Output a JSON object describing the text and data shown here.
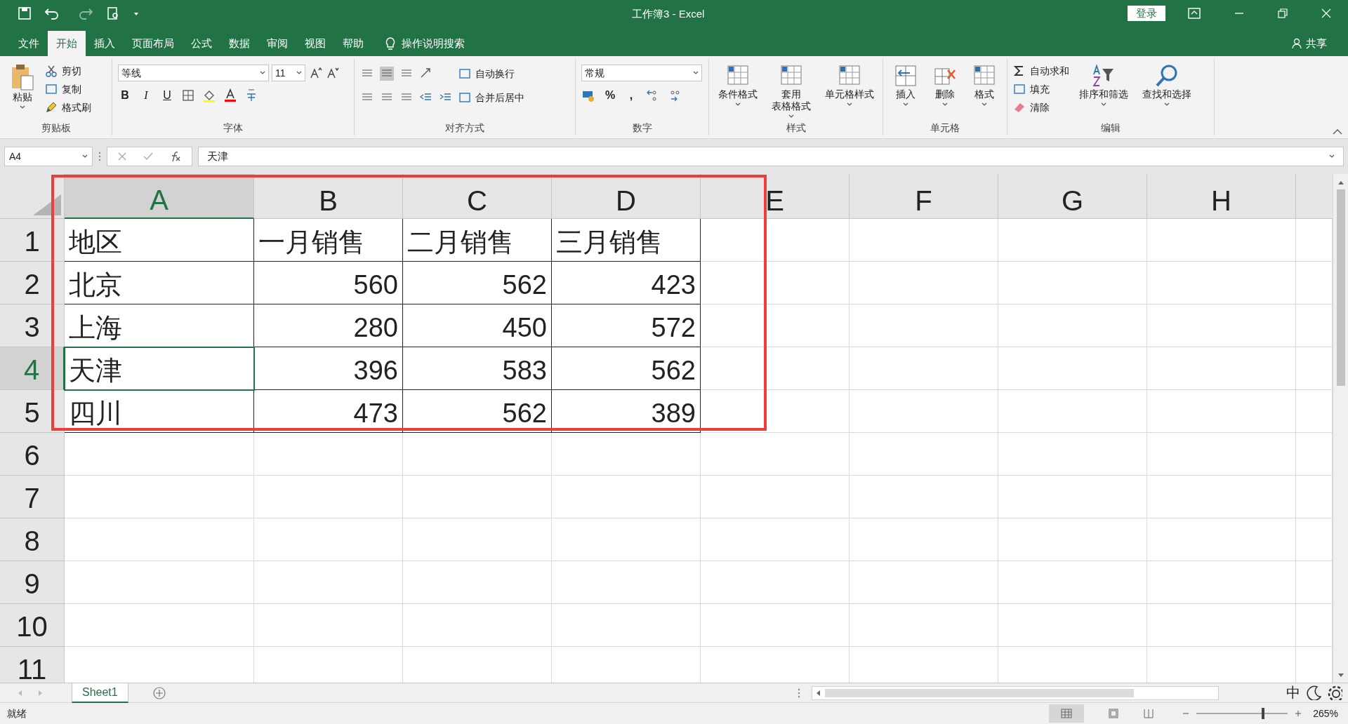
{
  "window": {
    "title": "工作簿3  -  Excel",
    "login": "登录"
  },
  "ribbon_tabs": [
    {
      "label": "文件",
      "selected": false
    },
    {
      "label": "开始",
      "selected": true
    },
    {
      "label": "插入",
      "selected": false
    },
    {
      "label": "页面布局",
      "selected": false
    },
    {
      "label": "公式",
      "selected": false
    },
    {
      "label": "数据",
      "selected": false
    },
    {
      "label": "审阅",
      "selected": false
    },
    {
      "label": "视图",
      "selected": false
    },
    {
      "label": "帮助",
      "selected": false
    }
  ],
  "tell_me": "操作说明搜索",
  "share": "共享",
  "ribbon_groups": [
    {
      "kind": "clipboard",
      "label": "剪贴板",
      "large": [
        {
          "lines": [
            "粘贴"
          ]
        }
      ],
      "small": [
        "剪切",
        "复制",
        "格式刷"
      ]
    },
    {
      "kind": "font",
      "label": "字体",
      "font": "等线",
      "size": "11",
      "buttons": [
        "B",
        "I",
        "U"
      ]
    },
    {
      "kind": "alignment",
      "label": "对齐方式",
      "small": [
        "自动换行",
        "合并后居中"
      ]
    },
    {
      "kind": "number",
      "label": "数字",
      "format": "常规",
      "buttons": [
        "%",
        ","
      ]
    },
    {
      "kind": "large",
      "label": "样式",
      "large": [
        {
          "lines": [
            "条件格式"
          ]
        },
        {
          "lines": [
            "套用",
            "表格格式"
          ]
        },
        {
          "lines": [
            "单元格样式"
          ]
        }
      ]
    },
    {
      "kind": "large",
      "label": "单元格",
      "large": [
        {
          "lines": [
            "插入"
          ]
        },
        {
          "lines": [
            "删除"
          ]
        },
        {
          "lines": [
            "格式"
          ]
        }
      ]
    },
    {
      "kind": "editing",
      "label": "编辑",
      "small": [
        "自动求和",
        "填充",
        "清除"
      ],
      "large": [
        {
          "lines": [
            "排序和筛选"
          ]
        },
        {
          "lines": [
            "查找和选择"
          ]
        }
      ]
    }
  ],
  "formula_bar": {
    "name_box": "A4",
    "formula": "天津"
  },
  "columns": [
    {
      "label": "A",
      "selected": true
    },
    {
      "label": "B",
      "selected": false
    },
    {
      "label": "C",
      "selected": false
    },
    {
      "label": "D",
      "selected": false
    },
    {
      "label": "E",
      "selected": false
    },
    {
      "label": "F",
      "selected": false
    },
    {
      "label": "G",
      "selected": false
    },
    {
      "label": "H",
      "selected": false
    }
  ],
  "rows": [
    {
      "label": "1",
      "selected": false,
      "cells": [
        {
          "text": "地区",
          "kind": "text"
        },
        {
          "text": "一月销售",
          "kind": "text"
        },
        {
          "text": "二月销售",
          "kind": "text"
        },
        {
          "text": "三月销售",
          "kind": "text"
        }
      ]
    },
    {
      "label": "2",
      "selected": false,
      "cells": [
        {
          "text": "北京",
          "kind": "text"
        },
        {
          "text": "560",
          "kind": "number"
        },
        {
          "text": "562",
          "kind": "number"
        },
        {
          "text": "423",
          "kind": "number"
        }
      ]
    },
    {
      "label": "3",
      "selected": false,
      "cells": [
        {
          "text": "上海",
          "kind": "text"
        },
        {
          "text": "280",
          "kind": "number"
        },
        {
          "text": "450",
          "kind": "number"
        },
        {
          "text": "572",
          "kind": "number"
        }
      ]
    },
    {
      "label": "4",
      "selected": true,
      "cells": [
        {
          "text": "天津",
          "kind": "text",
          "selected": true
        },
        {
          "text": "396",
          "kind": "number"
        },
        {
          "text": "583",
          "kind": "number"
        },
        {
          "text": "562",
          "kind": "number"
        }
      ]
    },
    {
      "label": "5",
      "selected": false,
      "cells": [
        {
          "text": "四川",
          "kind": "text"
        },
        {
          "text": "473",
          "kind": "number"
        },
        {
          "text": "562",
          "kind": "number"
        },
        {
          "text": "389",
          "kind": "number"
        }
      ]
    },
    {
      "label": "6",
      "selected": false,
      "cells": []
    },
    {
      "label": "7",
      "selected": false,
      "cells": []
    },
    {
      "label": "8",
      "selected": false,
      "cells": []
    },
    {
      "label": "9",
      "selected": false,
      "cells": []
    },
    {
      "label": "10",
      "selected": false,
      "cells": []
    },
    {
      "label": "11",
      "selected": false,
      "cells": []
    }
  ],
  "sheet_tabs": [
    {
      "label": "Sheet1",
      "selected": true
    }
  ],
  "ime": "中",
  "status_bar": {
    "status": "就绪",
    "zoom": "265%",
    "zoom_slider": {
      "level": 0.74
    }
  }
}
